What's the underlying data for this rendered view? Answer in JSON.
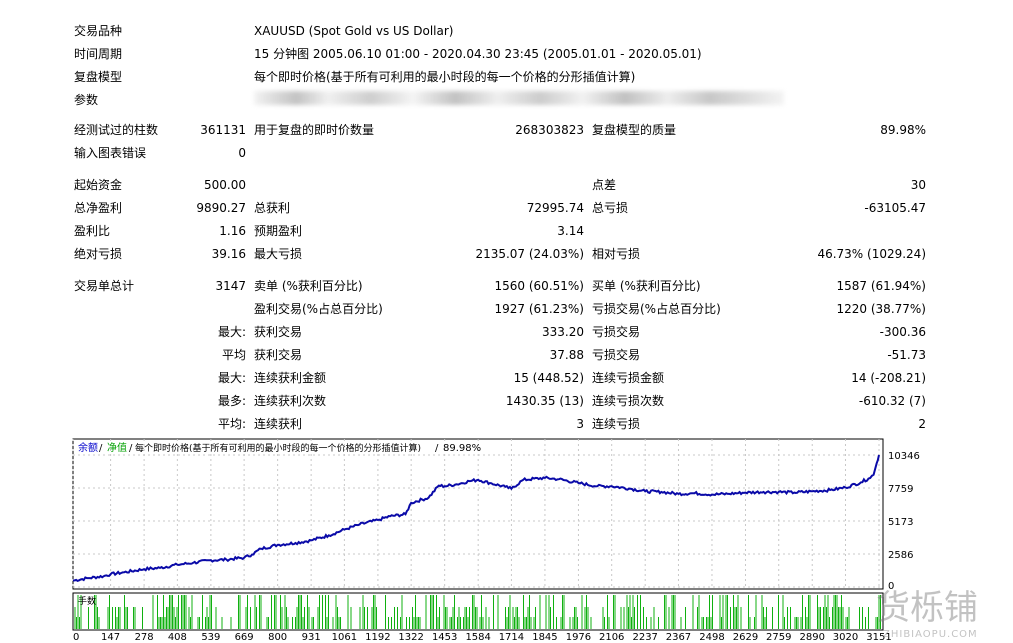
{
  "report": {
    "symbol_label": "交易品种",
    "symbol_value": "XAUUSD (Spot Gold vs US Dollar)",
    "period_label": "时间周期",
    "period_value": "15 分钟图 2005.06.10 01:00 - 2020.04.30 23:45 (2005.01.01 - 2020.05.01)",
    "model_label": "复盘模型",
    "model_value": "每个即时价格(基于所有可利用的最小时段的每一个价格的分形插值计算)",
    "params_label": "参数",
    "bars_label": "经测试过的柱数",
    "bars_value": "361131",
    "ticks_label": "用于复盘的即时价数量",
    "ticks_value": "268303823",
    "quality_label": "复盘模型的质量",
    "quality_value": "89.98%",
    "mismatch_label": "输入图表错误",
    "mismatch_value": "0",
    "deposit_label": "起始资金",
    "deposit_value": "500.00",
    "spread_label": "点差",
    "spread_value": "30",
    "net_label": "总净盈利",
    "net_value": "9890.27",
    "gross_profit_label": "总获利",
    "gross_profit_value": "72995.74",
    "gross_loss_label": "总亏损",
    "gross_loss_value": "-63105.47",
    "pf_label": "盈利比",
    "pf_value": "1.16",
    "payoff_label": "预期盈利",
    "payoff_value": "3.14",
    "abs_dd_label": "绝对亏损",
    "abs_dd_value": "39.16",
    "max_dd_label": "最大亏损",
    "max_dd_value": "2135.07 (24.03%)",
    "rel_dd_label": "相对亏损",
    "rel_dd_value": "46.73% (1029.24)",
    "total_trades_label": "交易单总计",
    "total_trades_value": "3147",
    "short_label": "卖单 (%获利百分比)",
    "short_value": "1560 (60.51%)",
    "long_label": "买单 (%获利百分比)",
    "long_value": "1587 (61.94%)",
    "profit_trades_label": "盈利交易(%占总百分比)",
    "profit_trades_value": "1927 (61.23%)",
    "loss_trades_label": "亏损交易(%占总百分比)",
    "loss_trades_value": "1220 (38.77%)",
    "largest_prefix": "最大:",
    "largest_profit_label": "获利交易",
    "largest_profit_value": "333.20",
    "largest_loss_label": "亏损交易",
    "largest_loss_value": "-300.36",
    "average_prefix": "平均",
    "average_profit_label": "获利交易",
    "average_profit_value": "37.88",
    "average_loss_label": "亏损交易",
    "average_loss_value": "-51.73",
    "max_consec_prefix": "最大:",
    "max_consec_wins_label": "连续获利金额",
    "max_consec_wins_value": "15 (448.52)",
    "max_consec_losses_label": "连续亏损金额",
    "max_consec_losses_value": "14 (-208.21)",
    "maximal_prefix": "最多:",
    "maximal_wins_label": "连续获利次数",
    "maximal_wins_value": "1430.35 (13)",
    "maximal_losses_label": "连续亏损次数",
    "maximal_losses_value": "-610.32 (7)",
    "avg_consec_prefix": "平均:",
    "avg_consec_wins_label": "连续获利",
    "avg_consec_wins_value": "3",
    "avg_consec_losses_label": "连续亏损",
    "avg_consec_losses_value": "2"
  },
  "chart": {
    "legend_balance": "余额",
    "legend_sep1": "/",
    "legend_equity": "净值",
    "legend_sep2": "/",
    "legend_model": "每个即时价格(基于所有可利用的最小时段的每一个价格的分形插值计算)",
    "legend_sep3": "/",
    "legend_quality": "89.98%",
    "volume_label": "手数",
    "colors": {
      "balance": "#0a0aa8",
      "volume": "#10b010",
      "frame": "#000000",
      "grid": "#c8c8c8",
      "legend_balance": "#0000cc",
      "legend_equity": "#00a000"
    }
  },
  "watermark": {
    "text": "货栎铺",
    "subtext": "ZHIBIAOPU.COM"
  },
  "chart_data": {
    "type": "line",
    "y_ticks": [
      "10346",
      "7759",
      "5173",
      "2586",
      "0"
    ],
    "x_ticks": [
      "0",
      "147",
      "278",
      "408",
      "539",
      "669",
      "800",
      "931",
      "1061",
      "1192",
      "1322",
      "1453",
      "1584",
      "1714",
      "1845",
      "1976",
      "2106",
      "2237",
      "2367",
      "2498",
      "2629",
      "2759",
      "2890",
      "3020",
      "3151"
    ],
    "ylim": [
      0,
      10346
    ],
    "xlim": [
      0,
      3151
    ],
    "series": [
      {
        "values": [
          [
            0,
            500
          ],
          [
            60,
            700
          ],
          [
            120,
            850
          ],
          [
            147,
            1000
          ],
          [
            200,
            1150
          ],
          [
            278,
            1400
          ],
          [
            340,
            1500
          ],
          [
            408,
            1750
          ],
          [
            470,
            1900
          ],
          [
            539,
            2100
          ],
          [
            600,
            2150
          ],
          [
            669,
            2300
          ],
          [
            700,
            2550
          ],
          [
            735,
            3000
          ],
          [
            800,
            3300
          ],
          [
            870,
            3450
          ],
          [
            931,
            3650
          ],
          [
            1000,
            4050
          ],
          [
            1061,
            4500
          ],
          [
            1120,
            4900
          ],
          [
            1192,
            5250
          ],
          [
            1240,
            5550
          ],
          [
            1300,
            5700
          ],
          [
            1322,
            6600
          ],
          [
            1390,
            7000
          ],
          [
            1430,
            7950
          ],
          [
            1453,
            7900
          ],
          [
            1500,
            8050
          ],
          [
            1550,
            8300
          ],
          [
            1584,
            8400
          ],
          [
            1630,
            8150
          ],
          [
            1690,
            7850
          ],
          [
            1714,
            7700
          ],
          [
            1760,
            8400
          ],
          [
            1845,
            8550
          ],
          [
            1900,
            8450
          ],
          [
            1976,
            8150
          ],
          [
            2050,
            7900
          ],
          [
            2106,
            7900
          ],
          [
            2180,
            7700
          ],
          [
            2237,
            7500
          ],
          [
            2300,
            7450
          ],
          [
            2367,
            7300
          ],
          [
            2430,
            7350
          ],
          [
            2498,
            7250
          ],
          [
            2560,
            7300
          ],
          [
            2629,
            7400
          ],
          [
            2700,
            7450
          ],
          [
            2759,
            7450
          ],
          [
            2820,
            7400
          ],
          [
            2890,
            7500
          ],
          [
            2960,
            7600
          ],
          [
            3020,
            7800
          ],
          [
            3080,
            8200
          ],
          [
            3110,
            8500
          ],
          [
            3130,
            8800
          ],
          [
            3142,
            9700
          ],
          [
            3151,
            10346
          ]
        ]
      }
    ]
  }
}
